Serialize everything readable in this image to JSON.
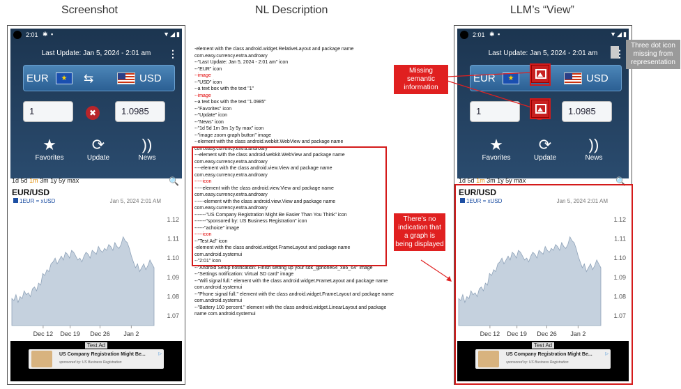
{
  "headings": {
    "left": "Screenshot",
    "middle": "NL Description",
    "right": "LLM’s “View”"
  },
  "status": {
    "time": "2:01"
  },
  "app": {
    "last_update": "Last Update: Jan 5, 2024 - 2:01 am",
    "from_currency": "EUR",
    "to_currency": "USD",
    "amount": "1",
    "result": "1.0985",
    "nav": [
      {
        "label": "Favorites",
        "icon": "star-icon"
      },
      {
        "label": "Update",
        "icon": "refresh-icon"
      },
      {
        "label": "News",
        "icon": "rss-icon"
      }
    ],
    "periods": [
      "1d",
      "5d",
      "1m",
      "3m",
      "1y",
      "5y",
      "max"
    ],
    "active_period": "1m",
    "pair": "EUR/USD",
    "legend": "1EUR = xUSD",
    "chart_date": "Jan 5, 2024 2:01 AM",
    "ad_label": "Test Ad",
    "ad_title": "US Company Registration Might Be...",
    "ad_sponsor": "sponsored by: US Business Registration"
  },
  "chart_data": {
    "type": "area",
    "x_ticks": [
      "Dec 12",
      "Dec 19",
      "Dec 26",
      "Jan 2"
    ],
    "y_ticks": [
      1.07,
      1.08,
      1.09,
      1.1,
      1.11,
      1.12
    ],
    "ylim": [
      1.065,
      1.125
    ],
    "grid": false,
    "values": [
      1.079,
      1.078,
      1.081,
      1.077,
      1.08,
      1.079,
      1.083,
      1.081,
      1.082,
      1.08,
      1.084,
      1.085,
      1.083,
      1.087,
      1.086,
      1.092,
      1.091,
      1.094,
      1.093,
      1.097,
      1.098,
      1.1,
      1.097,
      1.099,
      1.101,
      1.099,
      1.103,
      1.102,
      1.1,
      1.104,
      1.103,
      1.101,
      1.099,
      1.1,
      1.098,
      1.101,
      1.103,
      1.102,
      1.1,
      1.104,
      1.103,
      1.102,
      1.106,
      1.104,
      1.103,
      1.105,
      1.104,
      1.107,
      1.106,
      1.104,
      1.108,
      1.106,
      1.105,
      1.107,
      1.111,
      1.109,
      1.108,
      1.105,
      1.101,
      1.098,
      1.095,
      1.097,
      1.093,
      1.095,
      1.097,
      1.094,
      1.096,
      1.099,
      1.097,
      1.095
    ]
  },
  "description": [
    {
      "t": "-element with the class android.widget.RelativeLayout and package name com.easy.currency.extra.androary",
      "red": false
    },
    {
      "t": "--\"Last Update: Jan 5, 2024 - 2:01 am\" icon",
      "red": false
    },
    {
      "t": "--\"EUR\" icon",
      "red": false
    },
    {
      "t": "--image",
      "red": true
    },
    {
      "t": "--\"USD\" icon",
      "red": false
    },
    {
      "t": "--a text box with the text \"1\"",
      "red": false
    },
    {
      "t": "--image",
      "red": true
    },
    {
      "t": "--a text box with the text \"1.0985\"",
      "red": false
    },
    {
      "t": "--\"Favorites\" icon",
      "red": false
    },
    {
      "t": "--\"Update\" icon",
      "red": false
    },
    {
      "t": "--\"News\" icon",
      "red": false
    },
    {
      "t": "--\"1d 5d 1m 3m 1y 5y max\" icon",
      "red": false
    },
    {
      "t": "--\"image zoom graph button\" image",
      "red": false
    },
    {
      "t": "--element with the class android.webkit.WebView and package name com.easy.currency.extra.androary",
      "red": false
    },
    {
      "t": "---element with the class android.webkit.WebView and package name com.easy.currency.extra.androary",
      "red": false
    },
    {
      "t": "----element with the class android.view.View and package name com.easy.currency.extra.androary",
      "red": false
    },
    {
      "t": "-----icon",
      "red": true
    },
    {
      "t": "-----element with the class android.view.View and package name com.easy.currency.extra.androary",
      "red": false
    },
    {
      "t": "------element with the class android.view.View and package name com.easy.currency.extra.androary",
      "red": false
    },
    {
      "t": "-------\"US Company Registration Might Be Easier Than You Think\" icon",
      "red": false
    },
    {
      "t": "-------\"sponsored by: US Business Registration\" icon",
      "red": false
    },
    {
      "t": "------\"achoice\" image",
      "red": false
    },
    {
      "t": "-----icon",
      "red": true
    },
    {
      "t": "--\"Test Ad\" icon",
      "red": false
    },
    {
      "t": "-element with the class android.widget.FrameLayout and package name com.android.systemui",
      "red": false
    },
    {
      "t": "--\"2:01\" icon",
      "red": false
    },
    {
      "t": "--\"Android Setup notification: Finish setting up your sdk_gphone64_x86_64\" image",
      "red": false
    },
    {
      "t": "--\"Settings notification: Virtual SD card\" image",
      "red": false
    },
    {
      "t": "--\"Wifi signal full.\" element with the class android.widget.FrameLayout and package name com.android.systemui",
      "red": false
    },
    {
      "t": "--\"Phone signal full.\" element with the class android.widget.FrameLayout and package name com.android.systemui",
      "red": false
    },
    {
      "t": "--\"Battery 100 percent.\" element with the class android.widget.LinearLayout and package name com.android.systemui",
      "red": false
    }
  ],
  "callouts": {
    "missing_semantic": "Missing semantic information",
    "no_graph": "There's no indication that a graph is being displayed",
    "three_dot": "Three dot icon missing from representation"
  },
  "colors": {
    "accent": "#e02020",
    "period_active": "#e08a00",
    "chart_fill": "#c5d1de",
    "chart_line": "#8fa3b9"
  }
}
